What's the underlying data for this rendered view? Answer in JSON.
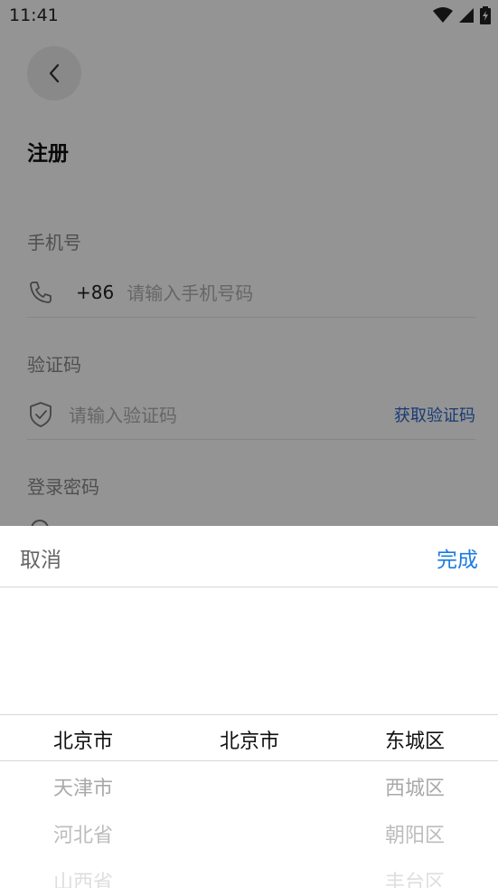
{
  "status_bar": {
    "time": "11:41"
  },
  "form": {
    "title": "注册",
    "phone": {
      "label": "手机号",
      "country_code": "+86",
      "placeholder": "请输入手机号码"
    },
    "code": {
      "label": "验证码",
      "placeholder": "请输入验证码",
      "get_code_label": "获取验证码"
    },
    "password": {
      "label": "登录密码"
    }
  },
  "picker": {
    "cancel_label": "取消",
    "done_label": "完成",
    "provinces": [
      "北京市",
      "天津市",
      "河北省",
      "山西省"
    ],
    "cities": [
      "北京市"
    ],
    "districts": [
      "东城区",
      "西城区",
      "朝阳区",
      "丰台区"
    ]
  },
  "colors": {
    "accent": "#1a7be3",
    "link": "#2b66c9"
  }
}
